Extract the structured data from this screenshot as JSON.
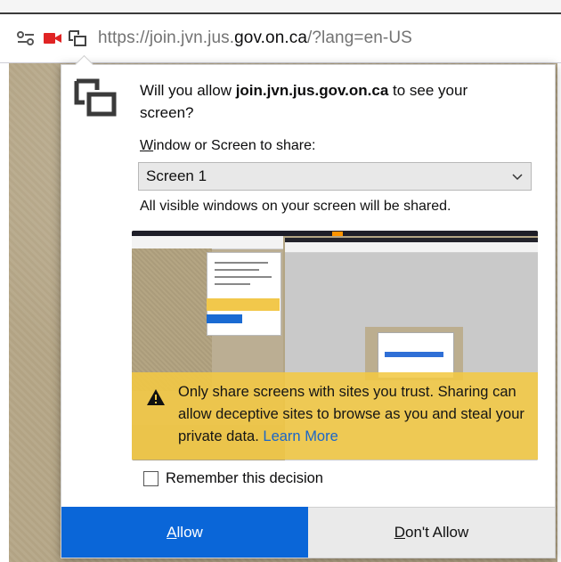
{
  "urlbar": {
    "url_prefix": "https://join.jvn.jus.",
    "url_domain": "gov.on.ca",
    "url_suffix": "/?lang=en-US",
    "icons": [
      "permissions-icon",
      "camera-icon",
      "screen-share-icon"
    ]
  },
  "dialog": {
    "question_prefix": "Will you allow ",
    "question_site": "join.jvn.jus.gov.on.ca",
    "question_suffix": " to see your screen?",
    "select_label_access_key": "W",
    "select_label_rest": "indow or Screen to share:",
    "select_value": "Screen 1",
    "info_text": "All visible windows on your screen will be shared.",
    "warning_text": "Only share screens with sites you trust. Sharing can allow deceptive sites to browse as you and steal your private data.",
    "learn_more": "Learn More",
    "remember_label": "Remember this decision",
    "remember_checked": false,
    "allow_access_key": "A",
    "allow_rest": "llow",
    "deny_access_key": "D",
    "deny_rest": "on't Allow"
  },
  "colors": {
    "allow_button": "#0a66d8",
    "warning_bg": "#f3c843",
    "link": "#1a66c9"
  }
}
